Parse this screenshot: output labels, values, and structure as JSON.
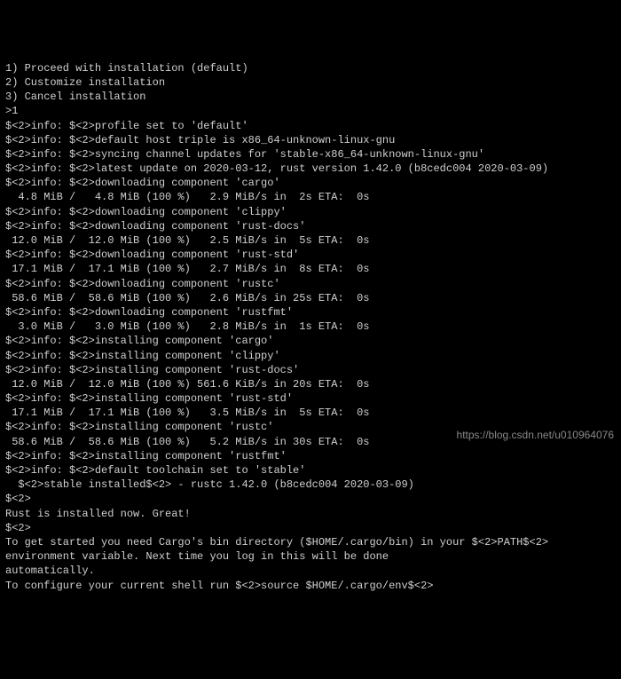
{
  "menu": [
    "1) Proceed with installation (default)",
    "2) Customize installation",
    "3) Cancel installation",
    ">1",
    ""
  ],
  "log": [
    "$<2>info: $<2>profile set to 'default'",
    "$<2>info: $<2>default host triple is x86_64-unknown-linux-gnu",
    "$<2>info: $<2>syncing channel updates for 'stable-x86_64-unknown-linux-gnu'",
    "$<2>info: $<2>latest update on 2020-03-12, rust version 1.42.0 (b8cedc004 2020-03-09)",
    "$<2>info: $<2>downloading component 'cargo'",
    "  4.8 MiB /   4.8 MiB (100 %)   2.9 MiB/s in  2s ETA:  0s",
    "$<2>info: $<2>downloading component 'clippy'",
    "$<2>info: $<2>downloading component 'rust-docs'",
    " 12.0 MiB /  12.0 MiB (100 %)   2.5 MiB/s in  5s ETA:  0s",
    "$<2>info: $<2>downloading component 'rust-std'",
    " 17.1 MiB /  17.1 MiB (100 %)   2.7 MiB/s in  8s ETA:  0s",
    "$<2>info: $<2>downloading component 'rustc'",
    " 58.6 MiB /  58.6 MiB (100 %)   2.6 MiB/s in 25s ETA:  0s",
    "$<2>info: $<2>downloading component 'rustfmt'",
    "  3.0 MiB /   3.0 MiB (100 %)   2.8 MiB/s in  1s ETA:  0s",
    "$<2>info: $<2>installing component 'cargo'",
    "$<2>info: $<2>installing component 'clippy'",
    "$<2>info: $<2>installing component 'rust-docs'",
    " 12.0 MiB /  12.0 MiB (100 %) 561.6 KiB/s in 20s ETA:  0s",
    "$<2>info: $<2>installing component 'rust-std'",
    " 17.1 MiB /  17.1 MiB (100 %)   3.5 MiB/s in  5s ETA:  0s",
    "$<2>info: $<2>installing component 'rustc'",
    " 58.6 MiB /  58.6 MiB (100 %)   5.2 MiB/s in 30s ETA:  0s",
    "$<2>info: $<2>installing component 'rustfmt'",
    "$<2>info: $<2>default toolchain set to 'stable'",
    "",
    "  $<2>stable installed$<2> - rustc 1.42.0 (b8cedc004 2020-03-09)",
    "",
    "$<2>",
    "Rust is installed now. Great!",
    "$<2>",
    "To get started you need Cargo's bin directory ($HOME/.cargo/bin) in your $<2>PATH$<2>",
    "environment variable. Next time you log in this will be done",
    "automatically.",
    "",
    "To configure your current shell run $<2>source $HOME/.cargo/env$<2>"
  ],
  "watermark": "https://blog.csdn.net/u010964076"
}
